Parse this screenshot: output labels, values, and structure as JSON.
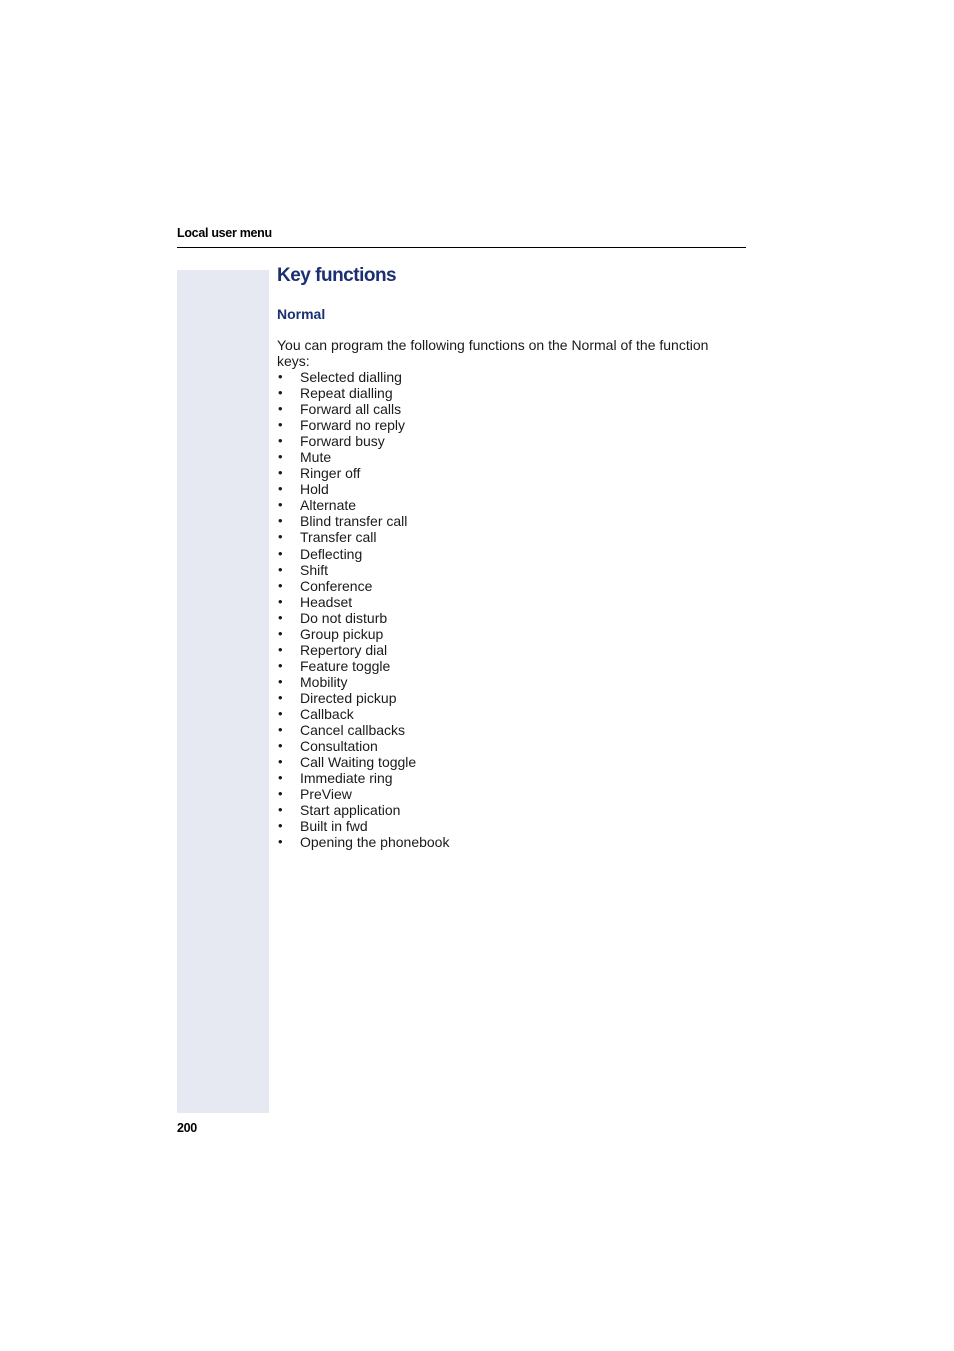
{
  "header": {
    "running_title": "Local user menu"
  },
  "section": {
    "title": "Key functions",
    "subtitle": "Normal",
    "intro": "You can program the following functions on the Normal of the function keys:",
    "functions": [
      "Selected dialling",
      "Repeat dialling",
      "Forward all calls",
      "Forward no reply",
      "Forward busy",
      "Mute",
      "Ringer off",
      "Hold",
      "Alternate",
      "Blind transfer call",
      "Transfer call",
      "Deflecting",
      "Shift",
      "Conference",
      "Headset",
      "Do not disturb",
      "Group pickup",
      "Repertory dial",
      "Feature toggle",
      "Mobility",
      "Directed pickup",
      "Callback",
      "Cancel callbacks",
      "Consultation",
      "Call Waiting toggle",
      "Immediate ring",
      "PreView",
      "Start application",
      "Built in fwd",
      "Opening the phonebook"
    ]
  },
  "footer": {
    "page_number": "200"
  },
  "colors": {
    "heading": "#1b2f72",
    "side_band": "#e6e8f2"
  },
  "bullet_glyph": "•"
}
